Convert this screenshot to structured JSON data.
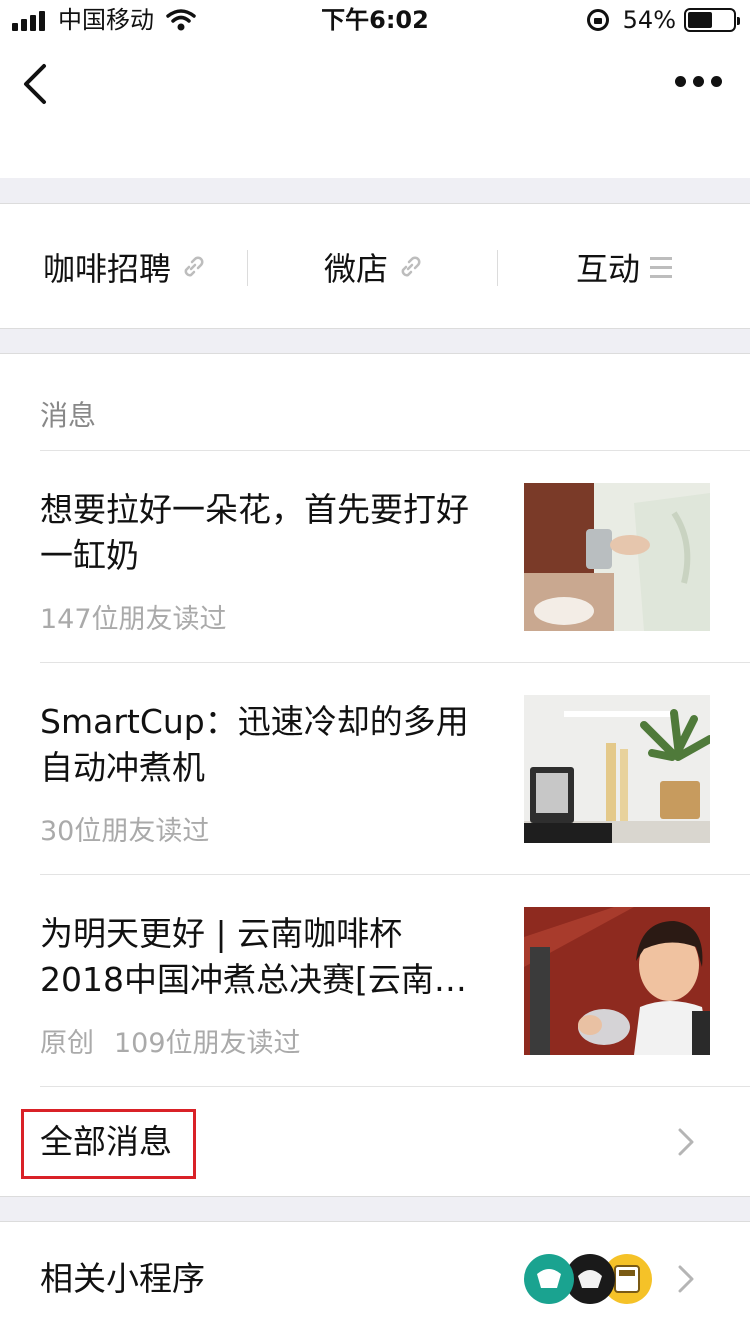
{
  "status_bar": {
    "carrier": "中国移动",
    "time": "下午6:02",
    "battery_percent_text": "54%",
    "battery_level": 0.54
  },
  "menu": {
    "items": [
      {
        "label": "咖啡招聘",
        "icon": "link-icon"
      },
      {
        "label": "微店",
        "icon": "link-icon"
      },
      {
        "label": "互动",
        "icon": "menu-lines-icon"
      }
    ]
  },
  "messages": {
    "header": "消息",
    "articles": [
      {
        "title": "想要拉好一朵花，首先要打好一缸奶",
        "original": "",
        "reads": "147位朋友读过"
      },
      {
        "title": "SmartCup：迅速冷却的多用自动冲煮机",
        "original": "",
        "reads": "30位朋友读过"
      },
      {
        "title": "为明天更好 | 云南咖啡杯2018中国冲煮总决赛[云南…",
        "original": "原创",
        "reads": "109位朋友读过"
      }
    ],
    "all_label": "全部消息"
  },
  "mini_programs": {
    "label": "相关小程序"
  },
  "colors": {
    "highlight_box": "#d92127",
    "background": "#efeff4"
  }
}
